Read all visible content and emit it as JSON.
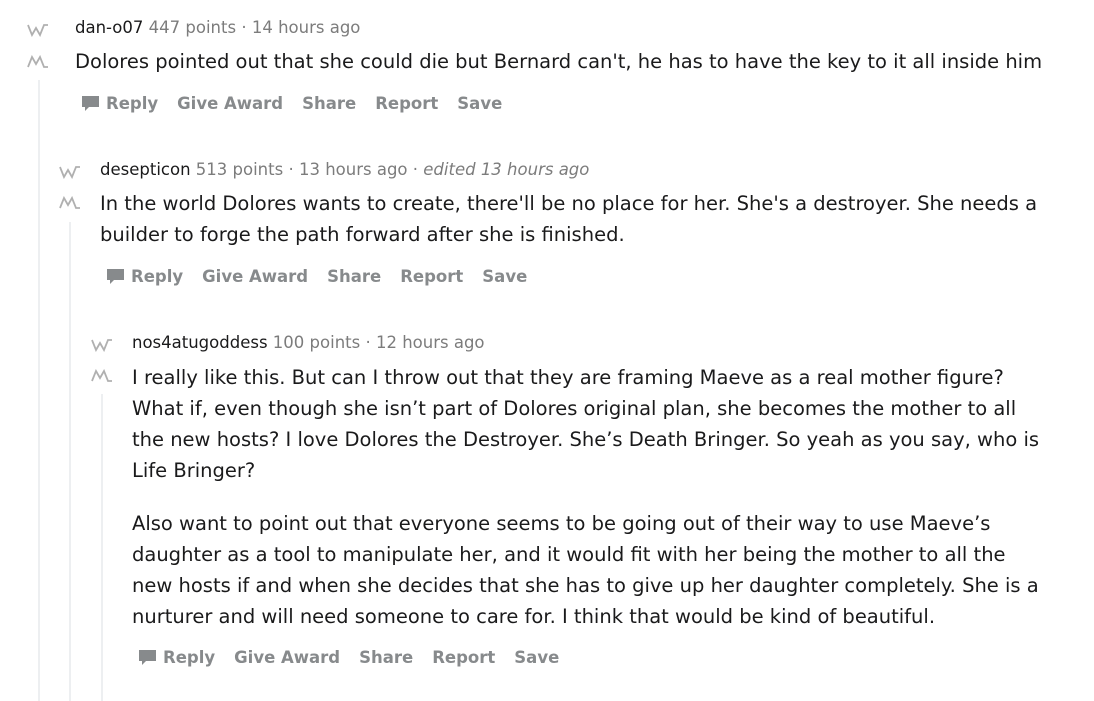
{
  "comments": [
    {
      "author": "dan-o07",
      "points": "447 points",
      "time": "14 hours ago",
      "edited": "",
      "paragraphs": [
        "Dolores pointed out that she could die but Bernard can't, he has to have the key to it all inside him"
      ],
      "actions": [
        "Reply",
        "Give Award",
        "Share",
        "Report",
        "Save"
      ]
    },
    {
      "author": "desepticon",
      "points": "513 points",
      "time": "13 hours ago",
      "edited": "edited 13 hours ago",
      "paragraphs": [
        "In the world Dolores wants to create, there'll be no place for her. She's a destroyer. She needs a builder to forge the path forward after she is finished."
      ],
      "actions": [
        "Reply",
        "Give Award",
        "Share",
        "Report",
        "Save"
      ]
    },
    {
      "author": "nos4atugoddess",
      "points": "100 points",
      "time": "12 hours ago",
      "edited": "",
      "paragraphs": [
        "I really like this. But can I throw out that they are framing Maeve as a real mother figure? What if, even though she isn’t part of Dolores original plan, she becomes the mother to all the new hosts? I love Dolores the Destroyer. She’s Death Bringer. So yeah as you say, who is Life Bringer?",
        "Also want to point out that everyone seems to be going out of their way to use Maeve’s daughter as a tool to manipulate her, and it would fit with her being the mother to all the new hosts if and when she decides that she has to give up her daughter completely. She is a nurturer and will need someone to care for. I think that would be kind of beautiful."
      ],
      "actions": [
        "Reply",
        "Give Award",
        "Share",
        "Report",
        "Save"
      ]
    }
  ],
  "separator": "·",
  "icons": {
    "upvote": "westworld-upvote-icon",
    "downvote": "westworld-downvote-icon",
    "reply": "comment-bubble-icon"
  },
  "colors": {
    "meta": "#7c7c7c",
    "action": "#878a8c",
    "thread_line": "#edeff1"
  }
}
